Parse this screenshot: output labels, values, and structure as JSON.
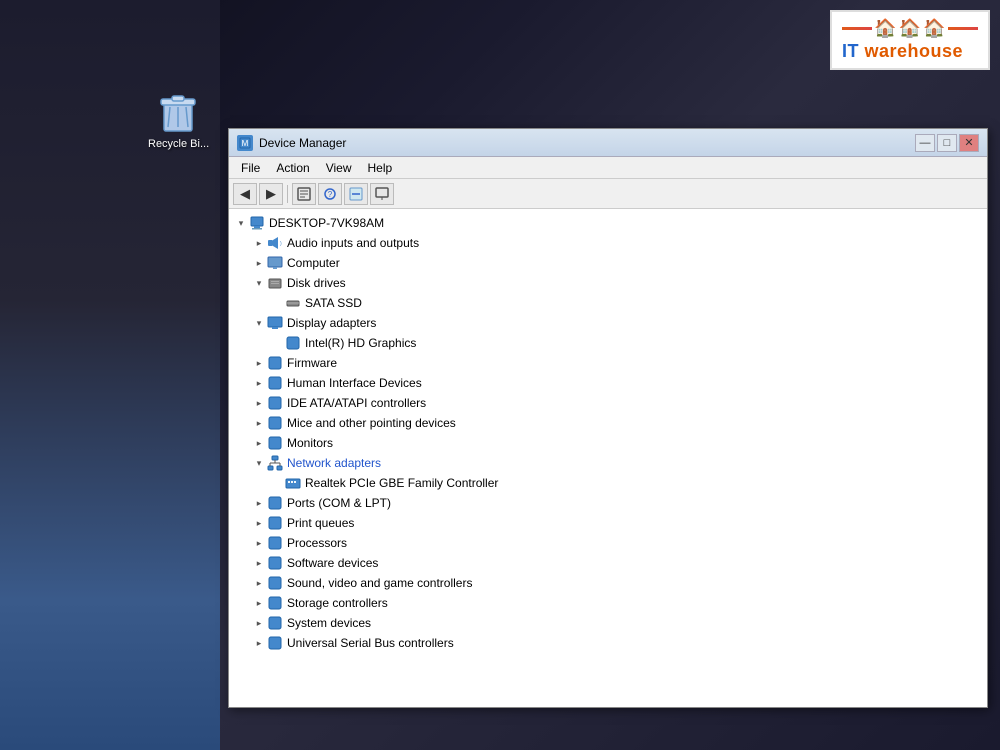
{
  "desktop": {
    "recycle_bin_label": "Recycle Bi..."
  },
  "logo": {
    "text_it": "IT ",
    "text_warehouse": "warehouse"
  },
  "window": {
    "title": "Device Manager",
    "minimize_label": "—",
    "maximize_label": "□",
    "close_label": "✕"
  },
  "menubar": {
    "items": [
      "File",
      "Action",
      "View",
      "Help"
    ]
  },
  "tree": {
    "root": "DESKTOP-7VK98AM",
    "items": [
      {
        "id": "root",
        "indent": 0,
        "expanded": true,
        "label": "DESKTOP-7VK98AM",
        "icon": "computer",
        "depth": 0
      },
      {
        "id": "audio",
        "indent": 1,
        "expanded": false,
        "label": "Audio inputs and outputs",
        "icon": "audio",
        "depth": 1
      },
      {
        "id": "computer",
        "indent": 1,
        "expanded": false,
        "label": "Computer",
        "icon": "monitor",
        "depth": 1
      },
      {
        "id": "disk",
        "indent": 1,
        "expanded": true,
        "label": "Disk drives",
        "icon": "disk",
        "depth": 1
      },
      {
        "id": "sata",
        "indent": 2,
        "expanded": false,
        "label": "SATA SSD",
        "icon": "drive",
        "depth": 2
      },
      {
        "id": "display",
        "indent": 1,
        "expanded": true,
        "label": "Display adapters",
        "icon": "display",
        "depth": 1
      },
      {
        "id": "intel",
        "indent": 2,
        "expanded": false,
        "label": "Intel(R) HD Graphics",
        "icon": "display-card",
        "depth": 2
      },
      {
        "id": "firmware",
        "indent": 1,
        "expanded": false,
        "label": "Firmware",
        "icon": "firmware",
        "depth": 1
      },
      {
        "id": "hid",
        "indent": 1,
        "expanded": false,
        "label": "Human Interface Devices",
        "icon": "hid",
        "depth": 1
      },
      {
        "id": "ide",
        "indent": 1,
        "expanded": false,
        "label": "IDE ATA/ATAPI controllers",
        "icon": "ide",
        "depth": 1
      },
      {
        "id": "mice",
        "indent": 1,
        "expanded": false,
        "label": "Mice and other pointing devices",
        "icon": "mouse",
        "depth": 1
      },
      {
        "id": "monitors",
        "indent": 1,
        "expanded": false,
        "label": "Monitors",
        "icon": "monitor2",
        "depth": 1
      },
      {
        "id": "network",
        "indent": 1,
        "expanded": true,
        "label": "Network adapters",
        "icon": "network",
        "depth": 1,
        "highlight": true
      },
      {
        "id": "realtek",
        "indent": 2,
        "expanded": false,
        "label": "Realtek PCIe GBE Family Controller",
        "icon": "nic",
        "depth": 2
      },
      {
        "id": "ports",
        "indent": 1,
        "expanded": false,
        "label": "Ports (COM & LPT)",
        "icon": "ports",
        "depth": 1
      },
      {
        "id": "print",
        "indent": 1,
        "expanded": false,
        "label": "Print queues",
        "icon": "printer",
        "depth": 1
      },
      {
        "id": "processors",
        "indent": 1,
        "expanded": false,
        "label": "Processors",
        "icon": "cpu",
        "depth": 1
      },
      {
        "id": "software",
        "indent": 1,
        "expanded": false,
        "label": "Software devices",
        "icon": "software",
        "depth": 1
      },
      {
        "id": "sound",
        "indent": 1,
        "expanded": false,
        "label": "Sound, video and game controllers",
        "icon": "sound",
        "depth": 1
      },
      {
        "id": "storage",
        "indent": 1,
        "expanded": false,
        "label": "Storage controllers",
        "icon": "storage",
        "depth": 1
      },
      {
        "id": "system",
        "indent": 1,
        "expanded": false,
        "label": "System devices",
        "icon": "system",
        "depth": 1
      },
      {
        "id": "usb",
        "indent": 1,
        "expanded": false,
        "label": "Universal Serial Bus controllers",
        "icon": "usb",
        "depth": 1
      }
    ]
  },
  "icons": {
    "computer": "🖥",
    "audio": "🔊",
    "monitor": "💻",
    "disk": "💾",
    "drive": "📀",
    "display": "🖥",
    "display-card": "🖥",
    "firmware": "📋",
    "hid": "🎮",
    "ide": "🔌",
    "mouse": "🖱",
    "monitor2": "🖥",
    "network": "🌐",
    "nic": "🌐",
    "ports": "🔌",
    "printer": "🖨",
    "cpu": "⚙",
    "software": "💿",
    "sound": "🎵",
    "storage": "💾",
    "system": "📁",
    "usb": "🔌"
  },
  "colors": {
    "accent_blue": "#2255cc",
    "toolbar_bg": "#f0f0f0",
    "selected_bg": "#3478d4",
    "logo_orange": "#e05a00",
    "logo_blue": "#2266cc"
  }
}
